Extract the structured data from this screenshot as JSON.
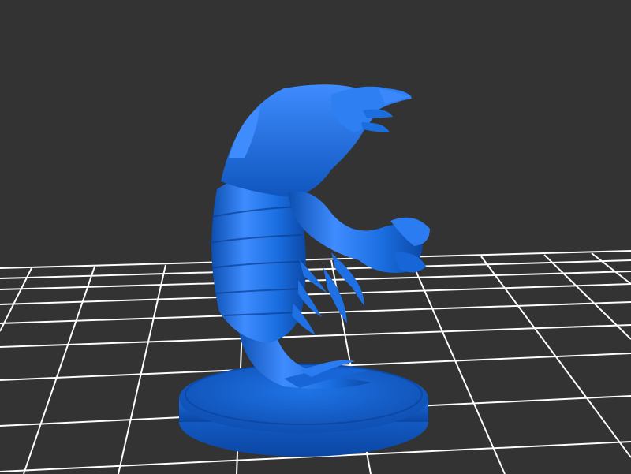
{
  "viewer": {
    "background_color": "#333333",
    "grid_color": "#ffffff",
    "model_color": "#1a6ee0",
    "model_shadow_color": "#0d4fb0",
    "model_highlight_color": "#4a98ff",
    "grid_visible": true,
    "model_subject": "insectoid-creature-miniature-on-round-base"
  }
}
